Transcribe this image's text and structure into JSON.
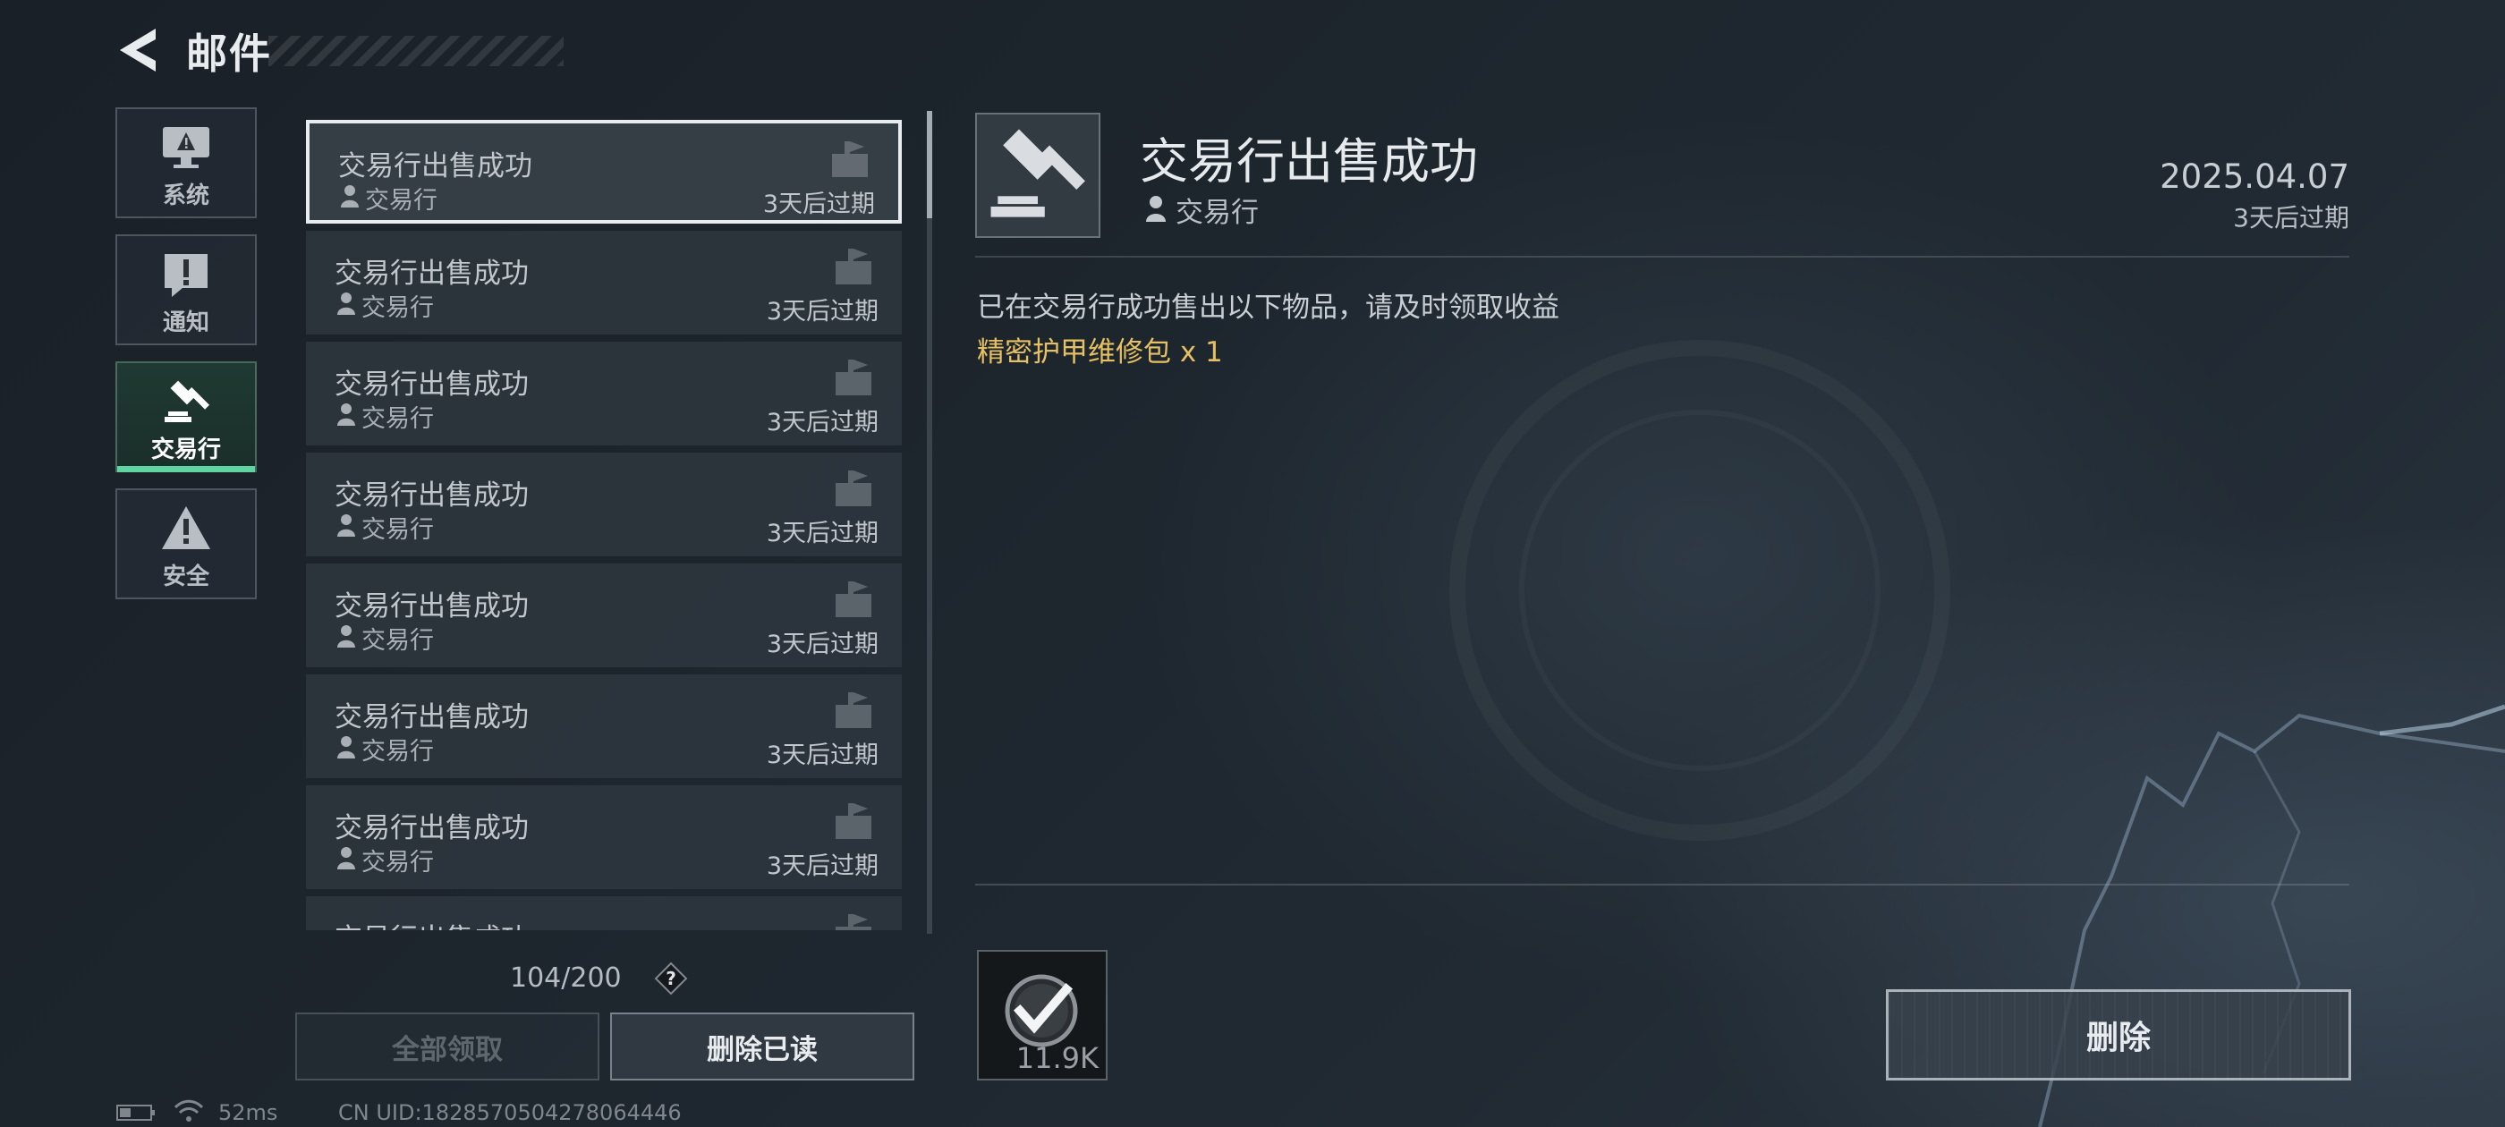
{
  "header": {
    "title": "邮件"
  },
  "categories": [
    {
      "label": "系统",
      "icon": "monitor-warning-icon"
    },
    {
      "label": "通知",
      "icon": "notice-icon"
    },
    {
      "label": "交易行",
      "icon": "gavel-icon",
      "active": true
    },
    {
      "label": "安全",
      "icon": "warning-triangle-icon"
    }
  ],
  "mails": [
    {
      "title": "交易行出售成功",
      "sender": "交易行",
      "expire": "3天后过期"
    },
    {
      "title": "交易行出售成功",
      "sender": "交易行",
      "expire": "3天后过期"
    },
    {
      "title": "交易行出售成功",
      "sender": "交易行",
      "expire": "3天后过期"
    },
    {
      "title": "交易行出售成功",
      "sender": "交易行",
      "expire": "3天后过期"
    },
    {
      "title": "交易行出售成功",
      "sender": "交易行",
      "expire": "3天后过期"
    },
    {
      "title": "交易行出售成功",
      "sender": "交易行",
      "expire": "3天后过期"
    },
    {
      "title": "交易行出售成功",
      "sender": "交易行",
      "expire": "3天后过期"
    },
    {
      "title": "交易行出售成功"
    }
  ],
  "list_footer": {
    "count": "104/200",
    "help": "?",
    "claim_all": "全部领取",
    "delete_read": "删除已读"
  },
  "detail": {
    "title": "交易行出售成功",
    "sender": "交易行",
    "date": "2025.04.07",
    "expire": "3天后过期",
    "body": "已在交易行成功售出以下物品，请及时领取收益",
    "item": "精密护甲维修包 x 1",
    "attachment_qty": "11.9K",
    "delete": "删除",
    "accent_item": "#e6c063"
  },
  "status": {
    "ping": "52ms",
    "uid": "CN UID:1828570504278064446"
  }
}
